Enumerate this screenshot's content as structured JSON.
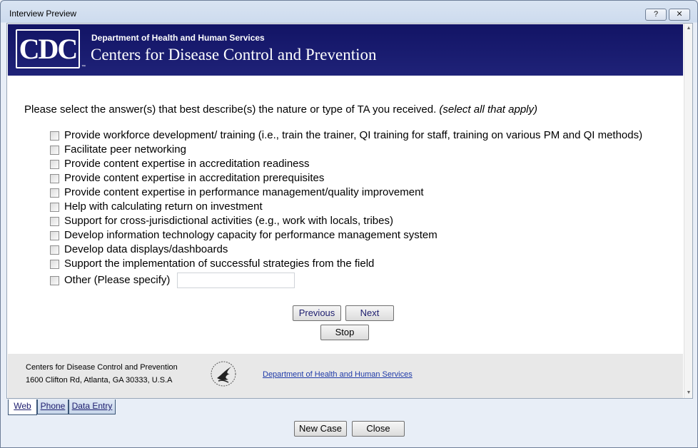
{
  "window": {
    "title": "Interview Preview",
    "help_label": "?",
    "close_label": "✕"
  },
  "banner": {
    "logo_text": "CDC",
    "tm": "™",
    "dept": "Department of Health and Human Services",
    "org": "Centers for Disease Control and Prevention"
  },
  "question": {
    "text": "Please select the answer(s) that best describe(s) the nature or type of TA you received.",
    "hint": "(select all that apply)"
  },
  "options": [
    "Provide workforce development/ training (i.e., train the trainer, QI training for staff, training on various PM and QI methods)",
    "Facilitate peer networking",
    "Provide content expertise in accreditation readiness",
    "Provide content expertise in accreditation prerequisites",
    "Provide content expertise in performance management/quality improvement",
    "Help with calculating return on investment",
    "Support for cross-jurisdictional activities (e.g., work with locals, tribes)",
    "Develop information technology capacity for performance management system",
    "Develop data displays/dashboards",
    "Support the implementation of successful strategies from the field",
    "Other (Please specify)"
  ],
  "other_input": {
    "value": ""
  },
  "nav": {
    "previous": "Previous",
    "next": "Next",
    "stop": "Stop"
  },
  "footer": {
    "org": "Centers for Disease Control and Prevention",
    "address": "1600 Clifton Rd, Atlanta, GA 30333, U.S.A",
    "link": "Department of Health and Human Services"
  },
  "tabs": [
    "Web",
    "Phone",
    "Data Entry"
  ],
  "bottom_buttons": {
    "new_case": "New Case",
    "close": "Close"
  }
}
